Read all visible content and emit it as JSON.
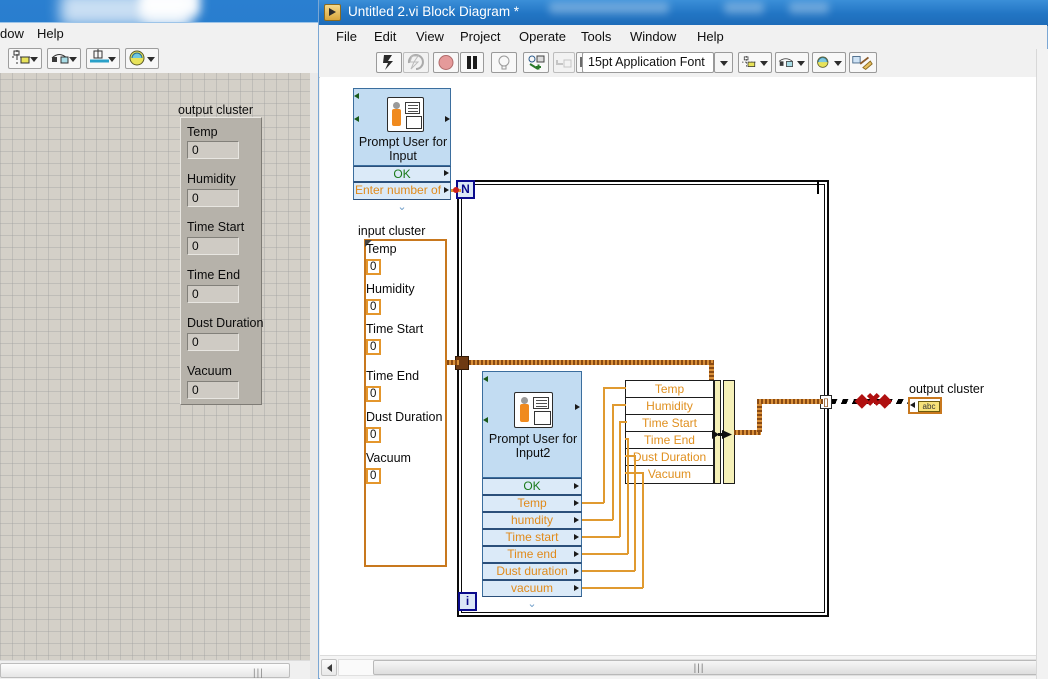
{
  "front_panel": {
    "menu": [
      "dow",
      "Help"
    ],
    "cluster_title": "output cluster",
    "fields": [
      {
        "label": "Temp",
        "value": "0"
      },
      {
        "label": "Humidity",
        "value": "0"
      },
      {
        "label": "Time Start",
        "value": "0"
      },
      {
        "label": "Time End",
        "value": "0"
      },
      {
        "label": "Dust Duration",
        "value": "0"
      },
      {
        "label": "Vacuum",
        "value": "0"
      }
    ]
  },
  "block_diagram": {
    "title": "Untitled 2.vi Block Diagram *",
    "menu": [
      "File",
      "Edit",
      "View",
      "Project",
      "Operate",
      "Tools",
      "Window",
      "Help"
    ],
    "toolbar": {
      "font_selector": "15pt Application Font"
    },
    "prompt_node_1": {
      "title": "Prompt User for\nInput",
      "outputs": [
        {
          "label": "OK",
          "color": "green"
        },
        {
          "label": "Enter number of",
          "color": "orange"
        }
      ]
    },
    "prompt_node_2": {
      "title": "Prompt User for\nInput2",
      "outputs": [
        {
          "label": "OK",
          "color": "green"
        },
        {
          "label": "Temp",
          "color": "orange"
        },
        {
          "label": "humdity",
          "color": "orange"
        },
        {
          "label": "Time start",
          "color": "orange"
        },
        {
          "label": "Time end",
          "color": "orange"
        },
        {
          "label": "Dust duration",
          "color": "orange"
        },
        {
          "label": "vacuum",
          "color": "orange"
        }
      ]
    },
    "input_cluster": {
      "title": "input cluster",
      "fields": [
        {
          "label": "Temp",
          "value": "0"
        },
        {
          "label": "Humidity",
          "value": "0"
        },
        {
          "label": "Time Start",
          "value": "0"
        },
        {
          "label": "Time End",
          "value": "0"
        },
        {
          "label": "Dust Duration",
          "value": "0"
        },
        {
          "label": "Vacuum",
          "value": "0"
        }
      ]
    },
    "bundle_node": {
      "rows": [
        "Temp",
        "Humidity",
        "Time Start",
        "Time End",
        "Dust Duration",
        "Vacuum"
      ]
    },
    "loop": {
      "count_terminal": "N",
      "iteration_terminal": "i",
      "index_tunnel": "[]"
    },
    "output_indicator": {
      "title": "output cluster",
      "glyph": "abc"
    }
  },
  "colors": {
    "title_bar": "#2275c4",
    "node_fill": "#c2dcf2",
    "cluster_orange": "#c8781e",
    "wire_orange": "#e09a30",
    "terminal_blue": "#0a0a8c",
    "error_red": "#b01010",
    "canvas": "#ffffff"
  }
}
